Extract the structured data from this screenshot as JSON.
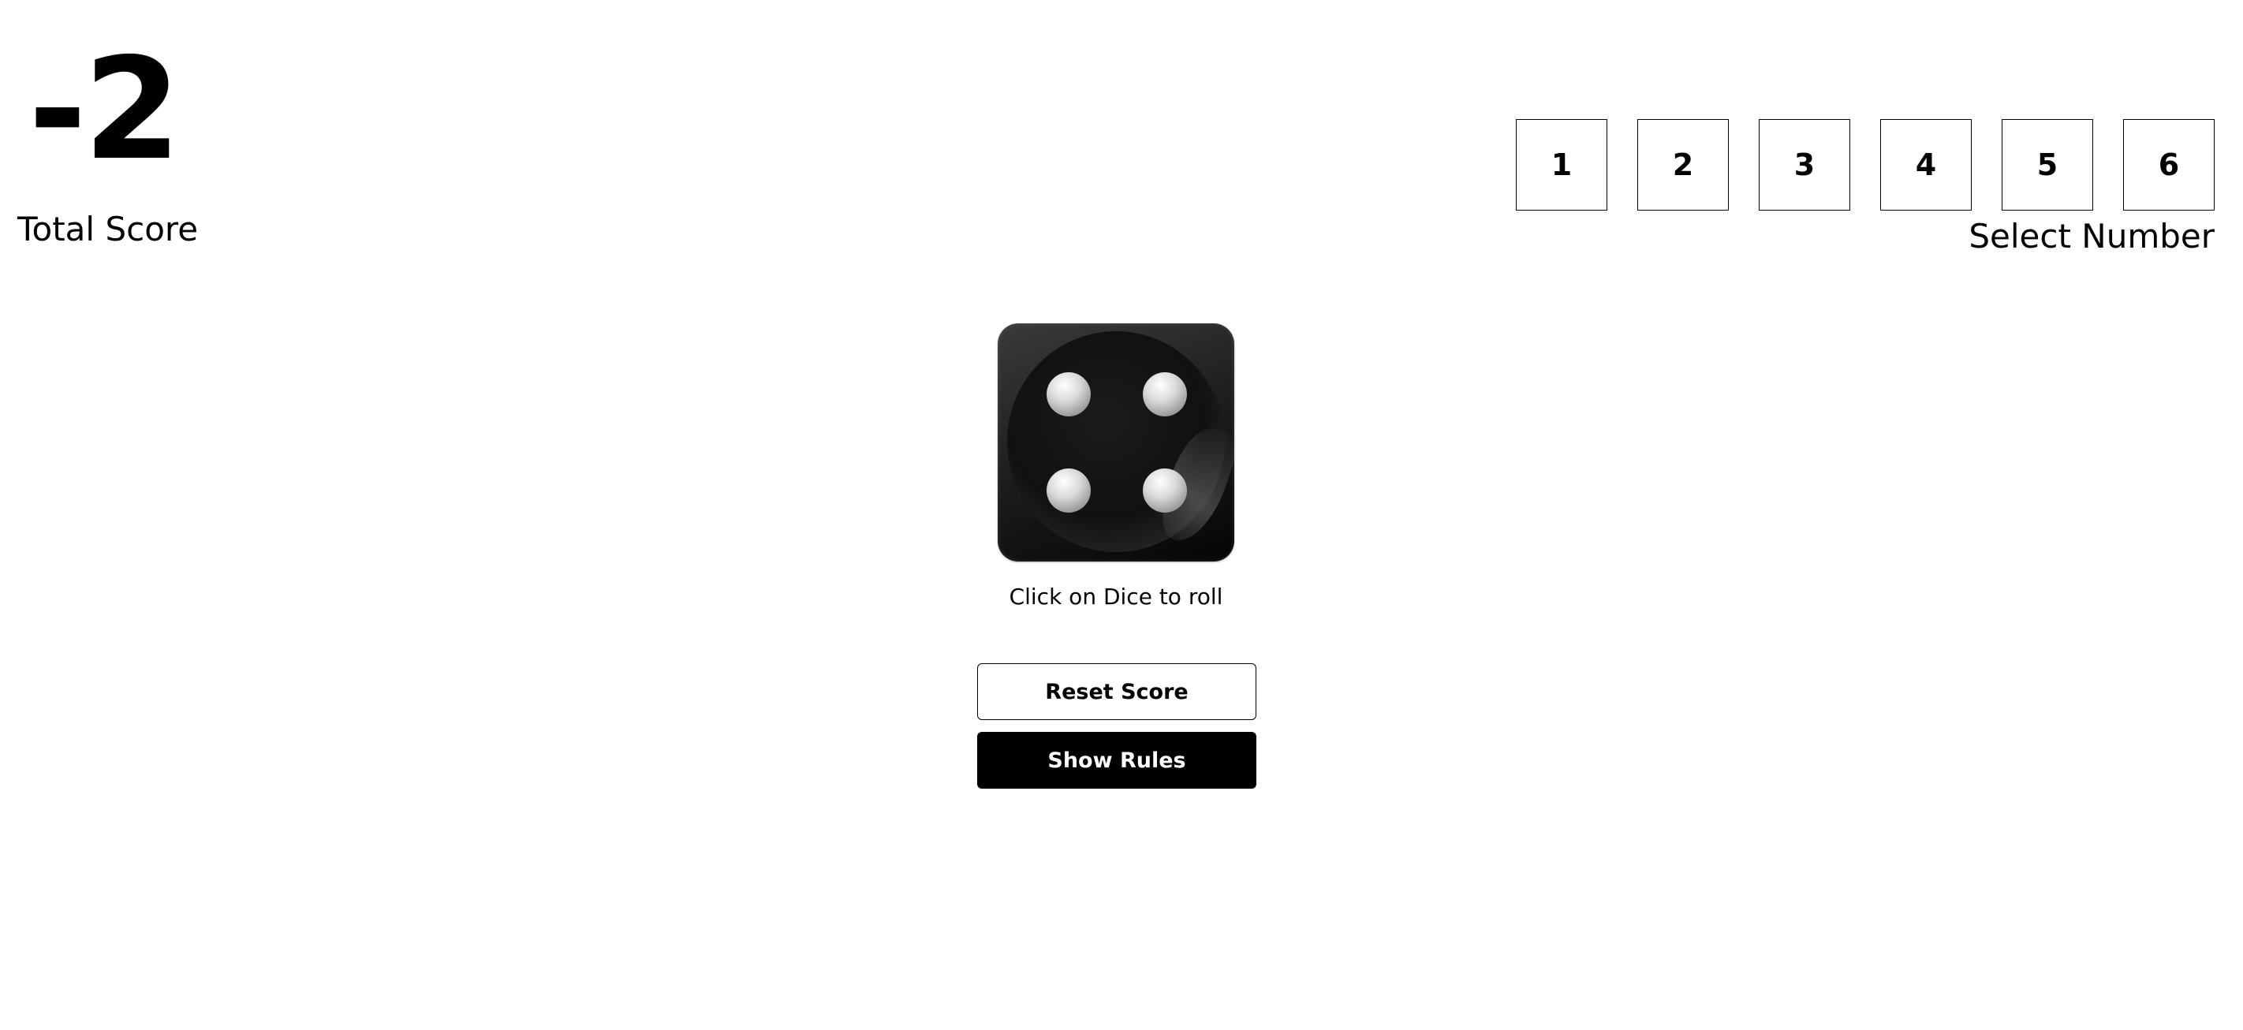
{
  "score": {
    "value": "-2",
    "label": "Total Score"
  },
  "selector": {
    "numbers": [
      "1",
      "2",
      "3",
      "4",
      "5",
      "6"
    ],
    "label": "Select Number"
  },
  "dice": {
    "icon": "dice-four-icon",
    "face_value": 4,
    "hint": "Click on Dice to roll"
  },
  "buttons": {
    "reset_label": "Reset Score",
    "rules_label": "Show Rules"
  },
  "colors": {
    "primary": "#000000",
    "background": "#ffffff",
    "button_text_inverse": "#ffffff"
  }
}
